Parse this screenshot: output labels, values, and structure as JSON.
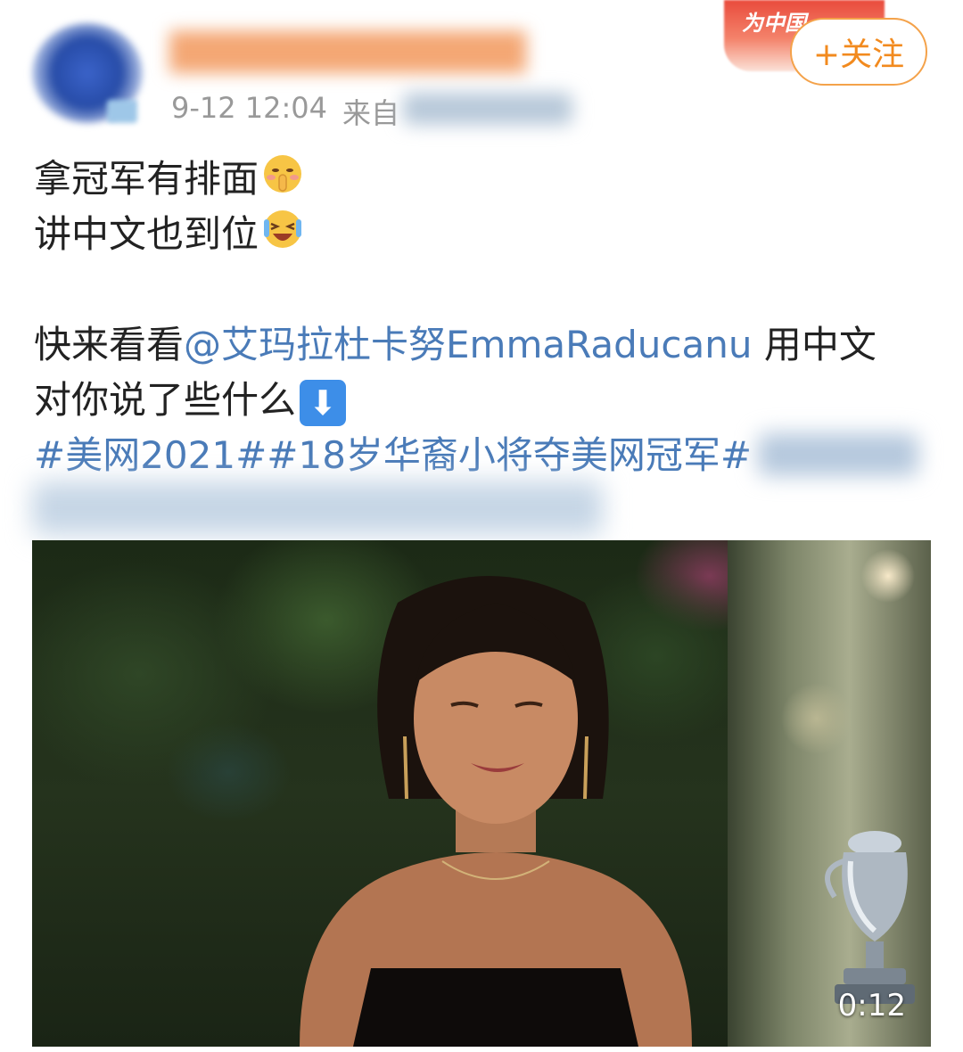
{
  "post": {
    "meta": {
      "time": "9-12 12:04",
      "source_prefix": "来自"
    },
    "follow_label": "+关注",
    "text": {
      "line1": "拿冠军有排面",
      "line2": "讲中文也到位",
      "line3_prefix": "快来看看",
      "mention": "@艾玛拉杜卡努EmmaRaducanu",
      "line3_suffix": " 用中文",
      "line4": "对你说了些什么",
      "hashtag1": "#美网2021#",
      "hashtag2": "#18岁华裔小将夺美网冠军#"
    },
    "emojis": {
      "line1": "shush-emoji",
      "line2": "laughing-emoji",
      "line4": "down-arrow-emoji"
    }
  },
  "video": {
    "duration": "0:12"
  },
  "colors": {
    "link": "#4a7bb8",
    "follow": "#f28a1e",
    "meta": "#999999"
  }
}
